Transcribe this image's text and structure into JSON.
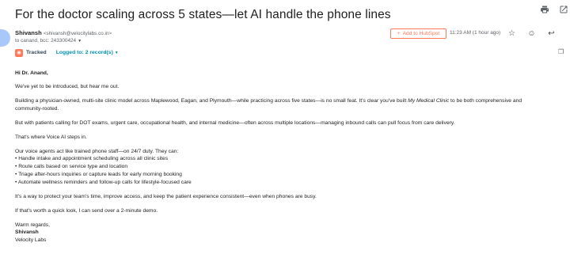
{
  "email": {
    "subject": "For the doctor scaling across 5 states—let AI handle the phone lines",
    "sender_name": "Shivansh",
    "sender_email": "<shivansh@velocitylabs.co.in>",
    "recipients": "to canand, bcc: 243300424",
    "add_to_hubspot": "Add to HubSpot",
    "timestamp": "11:23 AM (1 hour ago)",
    "tracked_label": "Tracked",
    "logged_to": "Logged to: 2 record(s)"
  },
  "icons": {
    "print": "print-icon",
    "open_new": "open-in-new-icon",
    "star": "star-icon",
    "emoji": "emoji-icon",
    "reply": "reply-icon",
    "more": "more-vert-icon",
    "hubspot": "hubspot-logo-icon"
  },
  "colors": {
    "hubspot_orange": "#ff7a59",
    "link_teal": "#0091ae"
  },
  "body": {
    "greeting": "Hi Dr. Anand,",
    "p1": "We've yet to be introduced, but hear me out.",
    "p2a": "Building a physician-owned, multi-site clinic model across Maplewood, Eagan, and Plymouth—while practicing across five states—is no small feat. It's clear you've built ",
    "p2_em": "My Medical Clinic",
    "p2b": " to be both comprehensive and",
    "p2c": "community-rooted.",
    "p3": "But with patients calling for DOT exams, urgent care, occupational health, and internal medicine—often across multiple locations—managing inbound calls can pull focus from care delivery.",
    "p4": "That's where Voice AI steps in.",
    "p5": "Our voice agents act like trained phone staff—on 24/7 duty. They can:",
    "bullets": [
      "• Handle intake and appointment scheduling across all clinic sites",
      "• Route calls based on service type and location",
      "• Triage after-hours inquiries or capture leads for early morning booking",
      "• Automate wellness reminders and follow-up calls for lifestyle-focused care"
    ],
    "p6": "It's a way to protect your team's time, improve access, and keep the patient experience consistent—even when phones are busy.",
    "p7": "If that's worth a quick look, I can send over a 2-minute demo.",
    "signoff": "Warm regards,",
    "sig_name": "Shivansh",
    "sig_company": "Velocity Labs"
  }
}
